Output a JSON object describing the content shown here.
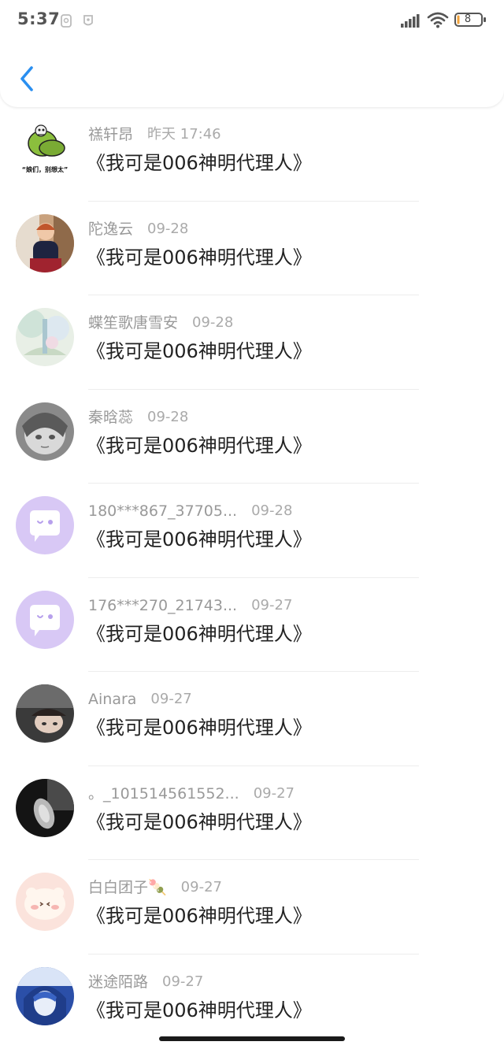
{
  "status_bar": {
    "time": "5:37",
    "battery": "8"
  },
  "header": {
    "back_icon": "chevron-left-icon",
    "accent": "#2a8ff0"
  },
  "items": [
    {
      "name": "禚轩昂",
      "time": "昨天 17:46",
      "title": "《我可是006神明代理人》"
    },
    {
      "name": "陀逸云",
      "time": "09-28",
      "title": "《我可是006神明代理人》"
    },
    {
      "name": "蝶笙歌唐雪安",
      "time": "09-28",
      "title": "《我可是006神明代理人》"
    },
    {
      "name": "秦晗蕊",
      "time": "09-28",
      "title": "《我可是006神明代理人》"
    },
    {
      "name": "180***867_37705...",
      "time": "09-28",
      "title": "《我可是006神明代理人》"
    },
    {
      "name": "176***270_21743...",
      "time": "09-27",
      "title": "《我可是006神明代理人》"
    },
    {
      "name": "Ainara",
      "time": "09-27",
      "title": "《我可是006神明代理人》"
    },
    {
      "name": "。_101514561552...",
      "time": "09-27",
      "title": "《我可是006神明代理人》"
    },
    {
      "name": "白白团子🍡",
      "time": "09-27",
      "title": "《我可是006神明代理人》"
    },
    {
      "name": "迷途陌路",
      "time": "09-27",
      "title": "《我可是006神明代理人》"
    }
  ],
  "avatar_meme_text": "“娘们，别想太”"
}
